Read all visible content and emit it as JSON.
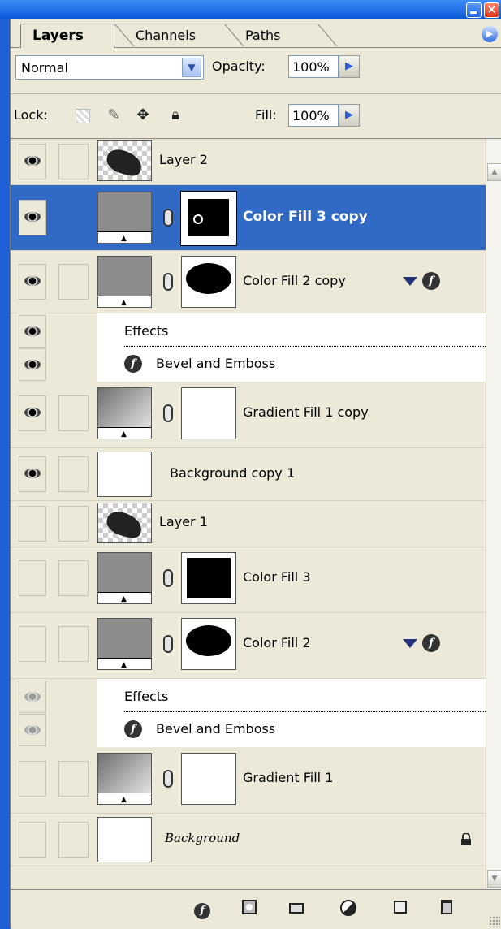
{
  "window": {
    "title_buttons": [
      "minimize-icon",
      "close-icon"
    ]
  },
  "tabs": [
    {
      "label": "Layers",
      "active": true
    },
    {
      "label": "Channels",
      "active": false
    },
    {
      "label": "Paths",
      "active": false
    }
  ],
  "toolbar": {
    "blend_mode": "Normal",
    "opacity_label": "Opacity:",
    "opacity_value": "100%",
    "lock_label": "Lock:",
    "fill_label": "Fill:",
    "fill_value": "100%"
  },
  "layers": [
    {
      "name": "Layer 2",
      "visible": true,
      "thumb": "checker-art"
    },
    {
      "name": "Color Fill 3 copy",
      "visible": true,
      "selected": true,
      "thumb": "gray-fill",
      "mask": "black-rect"
    },
    {
      "name": "Color Fill 2 copy",
      "visible": true,
      "thumb": "gray-fill",
      "mask": "black-ellipse",
      "has_effects": true
    },
    {
      "effects_label": "Effects",
      "effect_name": "Bevel and Emboss"
    },
    {
      "name": "Gradient Fill 1 copy",
      "visible": true,
      "thumb": "gradient-fill",
      "mask": "white"
    },
    {
      "name": "Background copy 1",
      "visible": true,
      "thumb": "white"
    },
    {
      "name": "Layer 1",
      "visible": false,
      "thumb": "checker-art"
    },
    {
      "name": "Color Fill 3",
      "visible": false,
      "thumb": "gray-fill",
      "mask": "black-rect"
    },
    {
      "name": "Color Fill 2",
      "visible": false,
      "thumb": "gray-fill",
      "mask": "black-ellipse",
      "has_effects": true
    },
    {
      "effects_label": "Effects",
      "effect_name": "Bevel and Emboss"
    },
    {
      "name": "Gradient Fill 1",
      "visible": false,
      "thumb": "gradient-fill",
      "mask": "white"
    },
    {
      "name": "Background",
      "visible": false,
      "thumb": "white",
      "locked": true
    }
  ],
  "footer_buttons": [
    "add-layer-style-icon",
    "add-mask-icon",
    "new-group-icon",
    "new-adjustment-layer-icon",
    "new-layer-icon",
    "delete-layer-icon"
  ],
  "colors": {
    "selection": "#316ac5",
    "panel": "#ece9d8",
    "titlebar": "#0a57d8"
  }
}
